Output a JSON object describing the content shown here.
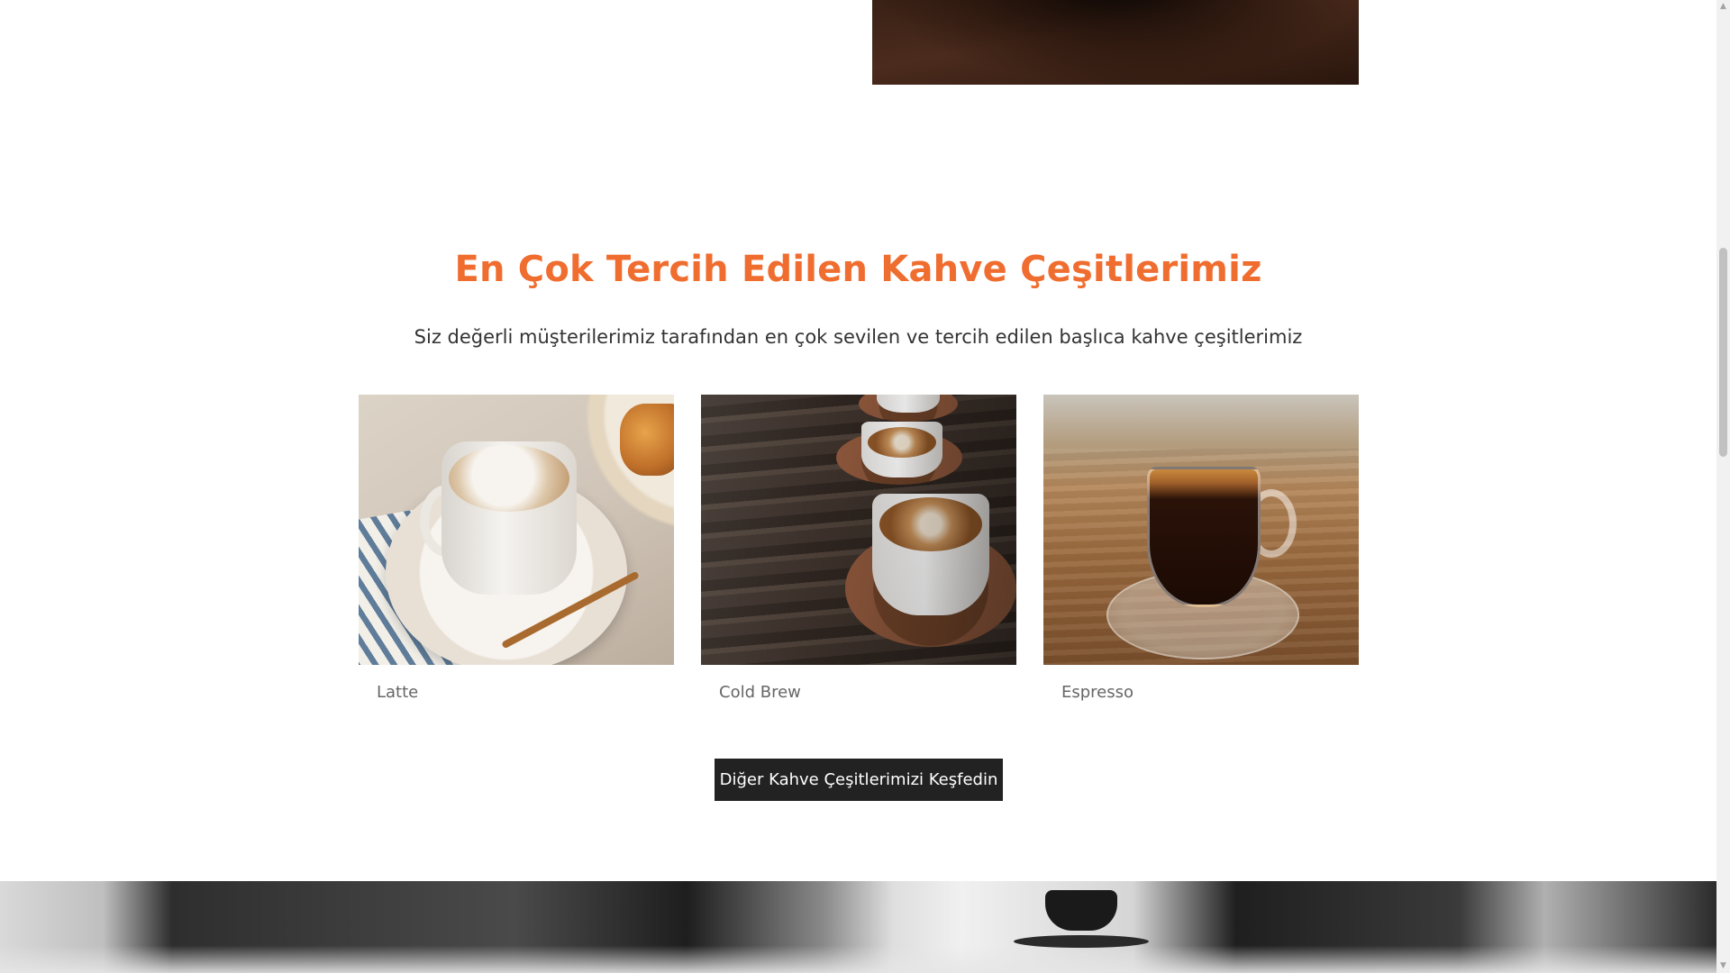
{
  "section": {
    "title": "En Çok Tercih Edilen Kahve Çeşitlerimiz",
    "subtitle": "Siz değerli müşterilerimiz tarafından en çok sevilen ve tercih edilen başlıca kahve çeşitlerimiz"
  },
  "products": [
    {
      "name": "Latte",
      "image": "latte-photo"
    },
    {
      "name": "Cold Brew",
      "image": "cold-brew-photo"
    },
    {
      "name": "Espresso",
      "image": "espresso-photo"
    }
  ],
  "cta": {
    "label": "Diğer Kahve Çeşitlerimizi Keşfedin"
  },
  "colors": {
    "title": "#f06d30",
    "button_bg": "#222222",
    "button_text": "#ffffff",
    "caption": "#666666"
  },
  "scrollbar": {
    "up_icon": "▲",
    "down_icon": "▼"
  }
}
